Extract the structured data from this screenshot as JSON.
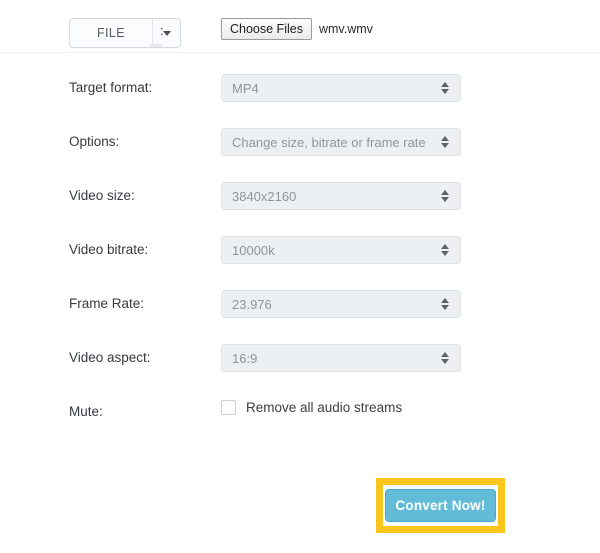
{
  "file_row": {
    "type_label": "FILE",
    "caret_icon": "chevron-down-icon",
    "separator": ":",
    "choose_files_label": "Choose Files",
    "file_name": "wmv.wmv"
  },
  "form": {
    "rows": [
      {
        "label": "Target format:",
        "value": "MP4"
      },
      {
        "label": "Options:",
        "value": "Change size, bitrate or frame rate"
      },
      {
        "label": "Video size:",
        "value": "3840x2160"
      },
      {
        "label": "Video bitrate:",
        "value": "10000k"
      },
      {
        "label": "Frame Rate:",
        "value": "23.976"
      },
      {
        "label": "Video aspect:",
        "value": "16:9"
      }
    ],
    "mute": {
      "label": "Mute:",
      "checkbox_label": "Remove all audio streams",
      "checked": false
    }
  },
  "actions": {
    "convert_label": "Convert Now!"
  },
  "colors": {
    "button_blue": "#62bcd8",
    "highlight_yellow": "#fac51d",
    "select_background": "#edf0f2",
    "select_text": "#8e959b",
    "label_text": "#363b41"
  }
}
